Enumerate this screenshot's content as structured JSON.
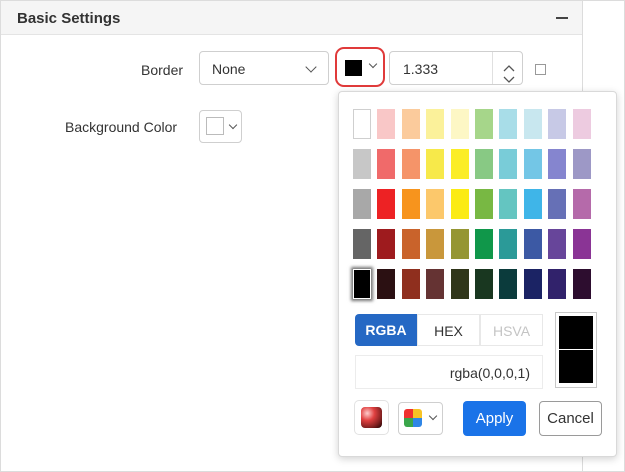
{
  "panel": {
    "title": "Basic Settings"
  },
  "border": {
    "label": "Border",
    "style_value": "None",
    "color": "#000000",
    "width_value": "1.333"
  },
  "background": {
    "label": "Background Color",
    "color": "#ffffff"
  },
  "picker": {
    "palette": [
      [
        "#ffffff",
        "#f9c7c7",
        "#fbcb9c",
        "#fbf19a",
        "#fdf7c5",
        "#a6d68a",
        "#a8dde8",
        "#c8e7ef",
        "#c7c9e6",
        "#edcbe0"
      ],
      [
        "#c7c7c7",
        "#f06a6a",
        "#f59469",
        "#f7e94a",
        "#fbed27",
        "#88c984",
        "#79ccd8",
        "#73c6e6",
        "#8585cf",
        "#9d98c6"
      ],
      [
        "#a8a8a8",
        "#ed2224",
        "#f7941d",
        "#fcc86b",
        "#fbeb14",
        "#78b843",
        "#64c5c1",
        "#3fb5e8",
        "#6670b6",
        "#b56aaa"
      ],
      [
        "#656565",
        "#9e1b1e",
        "#c9632b",
        "#c9973b",
        "#959632",
        "#10974a",
        "#2b9a98",
        "#3c59a4",
        "#67459a",
        "#8a3495"
      ],
      [
        "#000000",
        "#2b1012",
        "#8f2f1e",
        "#653333",
        "#2f3519",
        "#193720",
        "#0b3b3c",
        "#1b2364",
        "#31226b",
        "#2d0d2f"
      ]
    ],
    "selected": "#000000",
    "modes": [
      "RGBA",
      "HEX",
      "HSVA"
    ],
    "active_mode": "RGBA",
    "value": "rgba(0,0,0,1)",
    "preview_color": "#000000",
    "apply_label": "Apply",
    "cancel_label": "Cancel"
  }
}
